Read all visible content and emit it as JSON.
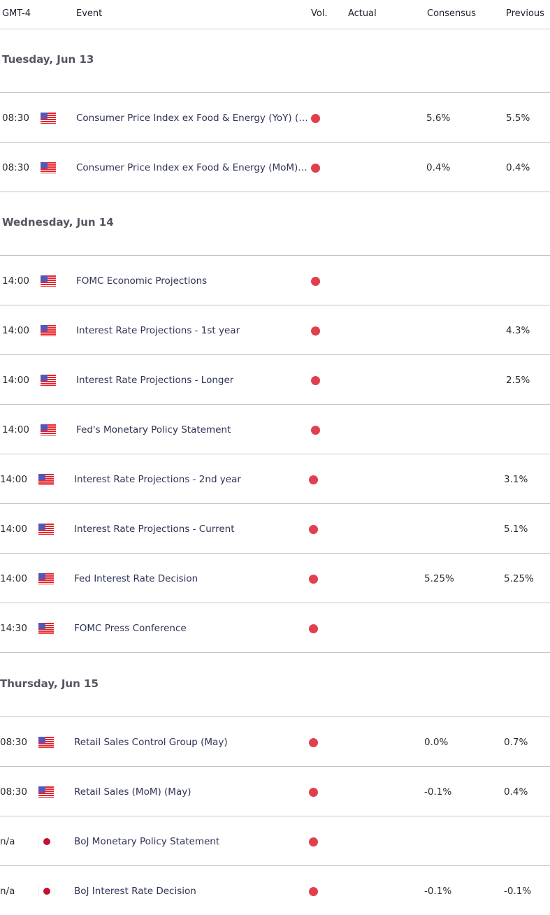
{
  "header": {
    "timezone": "GMT-4",
    "event": "Event",
    "vol": "Vol.",
    "actual": "Actual",
    "consensus": "Consensus",
    "previous": "Previous"
  },
  "colors": {
    "volatility_high": "#e0404e"
  },
  "days": [
    {
      "label": "Tuesday, Jun 13",
      "events": [
        {
          "time": "08:30",
          "country": "us-flag-icon",
          "event": "Consumer Price Index ex Food & Energy (YoY) (…",
          "volatility": "high",
          "actual": "",
          "consensus": "5.6%",
          "previous": "5.5%"
        },
        {
          "time": "08:30",
          "country": "us-flag-icon",
          "event": "Consumer Price Index ex Food & Energy (MoM)…",
          "volatility": "high",
          "actual": "",
          "consensus": "0.4%",
          "previous": "0.4%"
        }
      ]
    },
    {
      "label": "Wednesday, Jun 14",
      "events": [
        {
          "time": "14:00",
          "country": "us-flag-icon",
          "event": "FOMC Economic Projections",
          "volatility": "high",
          "actual": "",
          "consensus": "",
          "previous": ""
        },
        {
          "time": "14:00",
          "country": "us-flag-icon",
          "event": "Interest Rate Projections - 1st year",
          "volatility": "high",
          "actual": "",
          "consensus": "",
          "previous": "4.3%"
        },
        {
          "time": "14:00",
          "country": "us-flag-icon",
          "event": "Interest Rate Projections - Longer",
          "volatility": "high",
          "actual": "",
          "consensus": "",
          "previous": "2.5%"
        },
        {
          "time": "14:00",
          "country": "us-flag-icon",
          "event": "Fed's Monetary Policy Statement",
          "volatility": "high",
          "actual": "",
          "consensus": "",
          "previous": ""
        },
        {
          "time": "14:00",
          "country": "us-flag-icon",
          "event": "Interest Rate Projections - 2nd year",
          "volatility": "high",
          "actual": "",
          "consensus": "",
          "previous": "3.1%"
        },
        {
          "time": "14:00",
          "country": "us-flag-icon",
          "event": "Interest Rate Projections - Current",
          "volatility": "high",
          "actual": "",
          "consensus": "",
          "previous": "5.1%"
        },
        {
          "time": "14:00",
          "country": "us-flag-icon",
          "event": "Fed Interest Rate Decision",
          "volatility": "high",
          "actual": "",
          "consensus": "5.25%",
          "previous": "5.25%"
        },
        {
          "time": "14:30",
          "country": "us-flag-icon",
          "event": "FOMC Press Conference",
          "volatility": "high",
          "actual": "",
          "consensus": "",
          "previous": ""
        }
      ]
    },
    {
      "label": "Thursday, Jun 15",
      "events": [
        {
          "time": "08:30",
          "country": "us-flag-icon",
          "event": "Retail Sales Control Group (May)",
          "volatility": "high",
          "actual": "",
          "consensus": "0.0%",
          "previous": "0.7%"
        },
        {
          "time": "08:30",
          "country": "us-flag-icon",
          "event": "Retail Sales (MoM) (May)",
          "volatility": "high",
          "actual": "",
          "consensus": "-0.1%",
          "previous": "0.4%"
        },
        {
          "time": "n/a",
          "country": "jp-flag-icon",
          "event": "BoJ Monetary Policy Statement",
          "volatility": "high",
          "actual": "",
          "consensus": "",
          "previous": ""
        },
        {
          "time": "n/a",
          "country": "jp-flag-icon",
          "event": "BoJ Interest Rate Decision",
          "volatility": "high",
          "actual": "",
          "consensus": "-0.1%",
          "previous": "-0.1%"
        }
      ]
    }
  ]
}
